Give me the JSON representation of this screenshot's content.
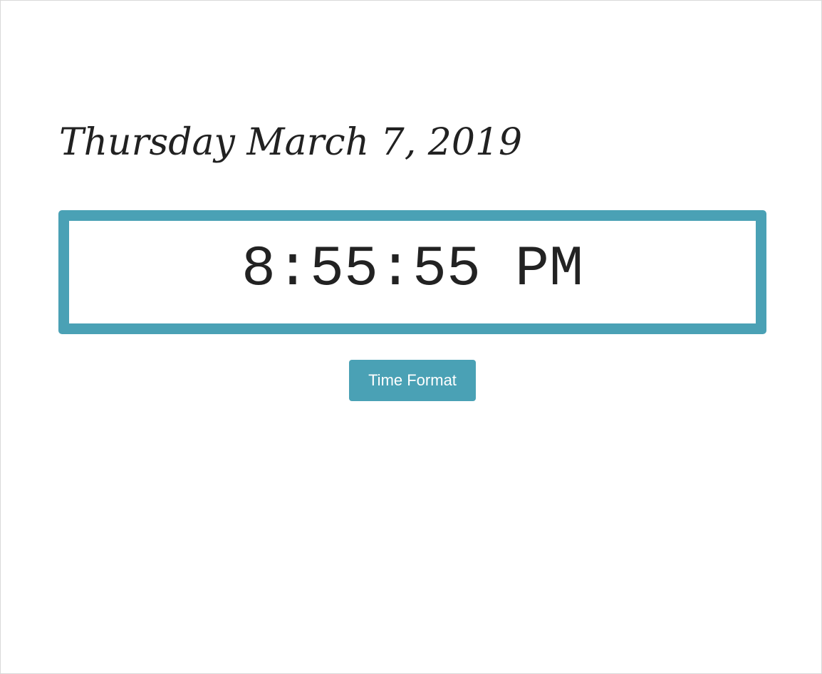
{
  "clock": {
    "date": "Thursday March 7, 2019",
    "time": "8:55:55 PM"
  },
  "controls": {
    "time_format_label": "Time Format"
  },
  "colors": {
    "accent": "#4aa1b5",
    "text": "#212121",
    "background": "#ffffff"
  }
}
